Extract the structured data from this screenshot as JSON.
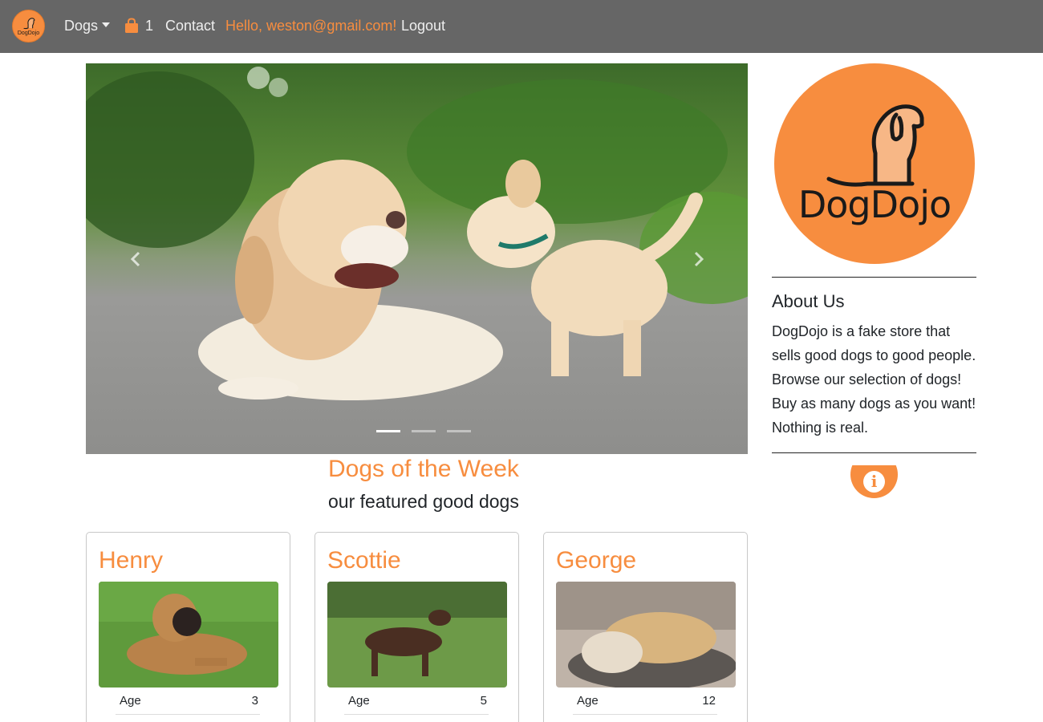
{
  "navbar": {
    "logo_text": "DogDojo",
    "dogs_label": "Dogs",
    "cart_count": "1",
    "contact_label": "Contact",
    "greeting": "Hello, weston@gmail.com!",
    "logout_label": "Logout",
    "background_color": "#666666",
    "accent_color": "#f78d3f"
  },
  "carousel": {
    "slide_count": 3,
    "active_index": 0,
    "prev_icon": "chevron-left-icon",
    "next_icon": "chevron-right-icon"
  },
  "featured": {
    "title": "Dogs of the Week",
    "subtitle": "our featured good dogs"
  },
  "cards": [
    {
      "name": "Henry",
      "age_label": "Age",
      "age": "3"
    },
    {
      "name": "Scottie",
      "age_label": "Age",
      "age": "5"
    },
    {
      "name": "George",
      "age_label": "Age",
      "age": "12"
    }
  ],
  "sidebar": {
    "logo_text": "DogDojo",
    "about_title": "About Us",
    "about_lines": [
      "DogDojo is a fake store that",
      "sells good dogs to good people.",
      "Browse our selection of dogs!",
      "Buy as many dogs as you want!",
      "Nothing is real."
    ],
    "info_icon": "info-icon",
    "info_glyph": "i"
  }
}
